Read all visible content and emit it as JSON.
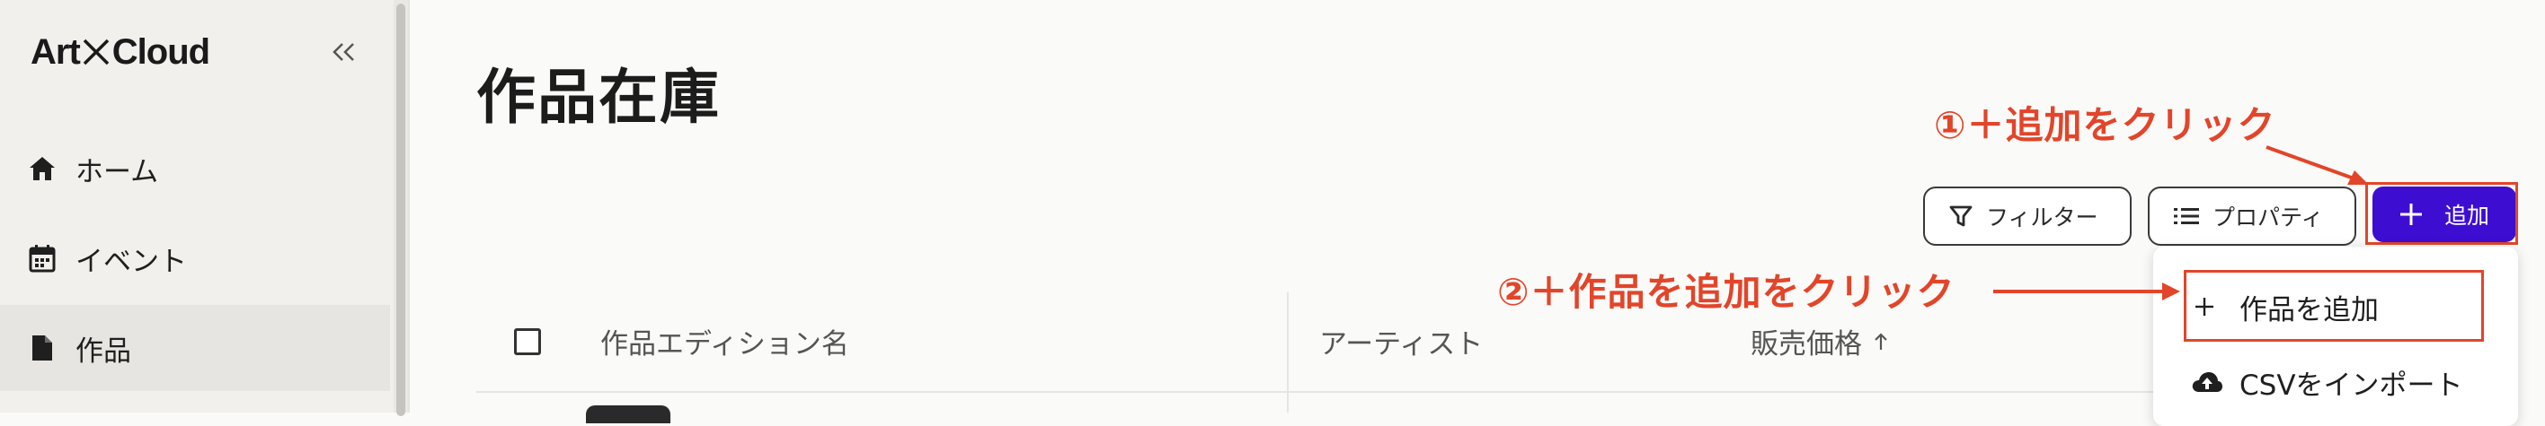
{
  "app": {
    "logo_left": "Art",
    "logo_right": "Cloud"
  },
  "sidebar": {
    "items": [
      {
        "label": "ホーム",
        "icon": "home-icon"
      },
      {
        "label": "イベント",
        "icon": "calendar-icon"
      },
      {
        "label": "作品",
        "icon": "document-icon",
        "active": true
      }
    ]
  },
  "main": {
    "title": "作品在庫",
    "toolbar": {
      "filter_label": "フィルター",
      "properties_label": "プロパティ",
      "add_label": "追加"
    },
    "add_menu": {
      "items": [
        {
          "label": "作品を追加",
          "icon": "plus-icon"
        },
        {
          "label": "CSVをインポート",
          "icon": "cloud-upload-icon"
        }
      ]
    },
    "table": {
      "columns": [
        "作品エディション名",
        "アーティスト",
        "販売価格"
      ]
    }
  },
  "annotations": {
    "step1": "①＋追加をクリック",
    "step2": "②＋作品を追加をクリック"
  },
  "colors": {
    "accent": "#3d0ed1",
    "annotation": "#e2452a",
    "sidebar_bg": "#f1f0ec"
  }
}
